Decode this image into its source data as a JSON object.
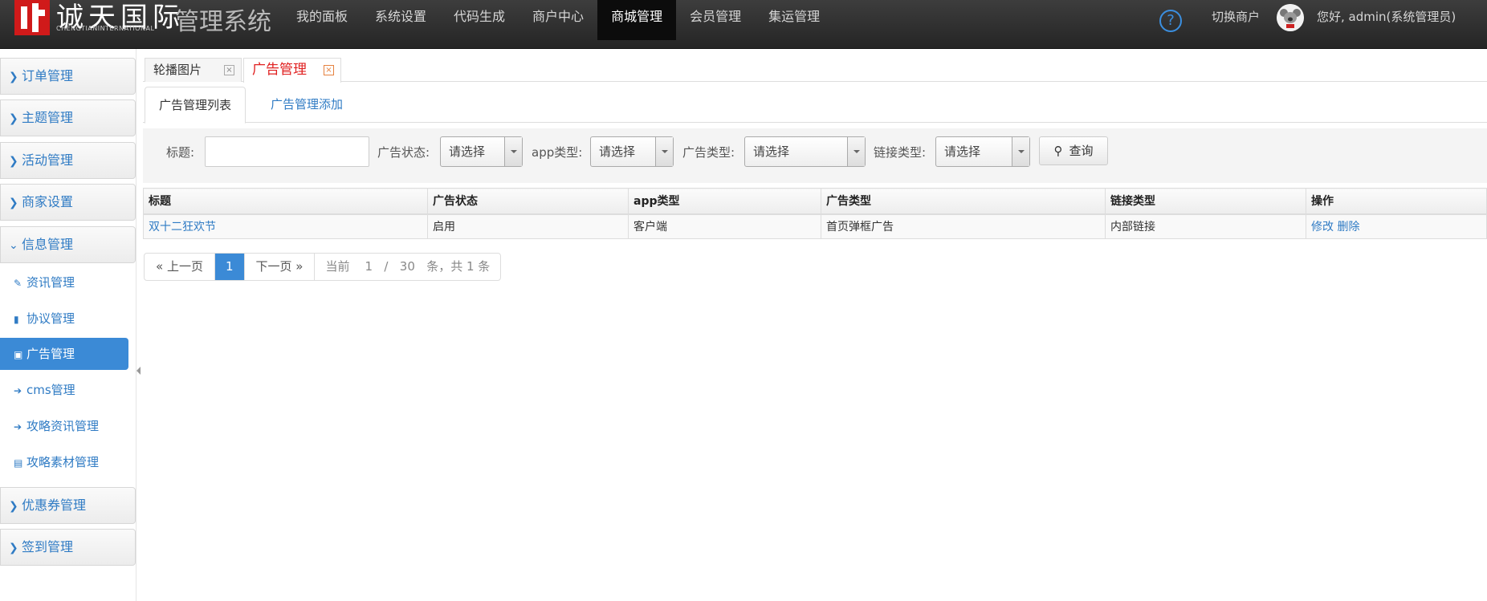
{
  "header": {
    "logo_text": "诚天国际",
    "logo_sub": "CHENGTIANINTERNATIONAL",
    "system_title": "管理系统",
    "nav": [
      "我的面板",
      "系统设置",
      "代码生成",
      "商户中心",
      "商城管理",
      "会员管理",
      "集运管理"
    ],
    "active_nav": "商城管理",
    "switch_label": "切换商户",
    "greeting": "您好, admin(系统管理员)"
  },
  "sidebar": {
    "groups": [
      "订单管理",
      "主题管理",
      "活动管理",
      "商家设置",
      "信息管理",
      "优惠券管理",
      "签到管理"
    ],
    "expanded": "信息管理",
    "sub_items": [
      "资讯管理",
      "协议管理",
      "广告管理",
      "cms管理",
      "攻略资讯管理",
      "攻略素材管理"
    ],
    "active_sub": "广告管理"
  },
  "tabs": [
    "轮播图片",
    "广告管理"
  ],
  "subtabs": [
    "广告管理列表",
    "广告管理添加"
  ],
  "filter": {
    "title_label": "标题:",
    "title_value": "",
    "ad_status_label": "广告状态:",
    "app_type_label": "app类型:",
    "ad_type_label": "广告类型:",
    "link_type_label": "链接类型:",
    "select_placeholder": "请选择",
    "query_label": "查询"
  },
  "table": {
    "headers": [
      "标题",
      "广告状态",
      "app类型",
      "广告类型",
      "链接类型",
      "操作"
    ],
    "rows": [
      {
        "title": "双十二狂欢节",
        "status": "启用",
        "app": "客户端",
        "ad_type": "首页弹框广告",
        "link_type": "内部链接",
        "edit": "修改",
        "delete": "删除"
      }
    ]
  },
  "pager": {
    "prev": "« 上一页",
    "current": "1",
    "next": "下一页 »",
    "info_pre": "当前",
    "info_page": "1",
    "info_sep": "/",
    "info_size": "30",
    "info_post": "条，共 1 条"
  }
}
